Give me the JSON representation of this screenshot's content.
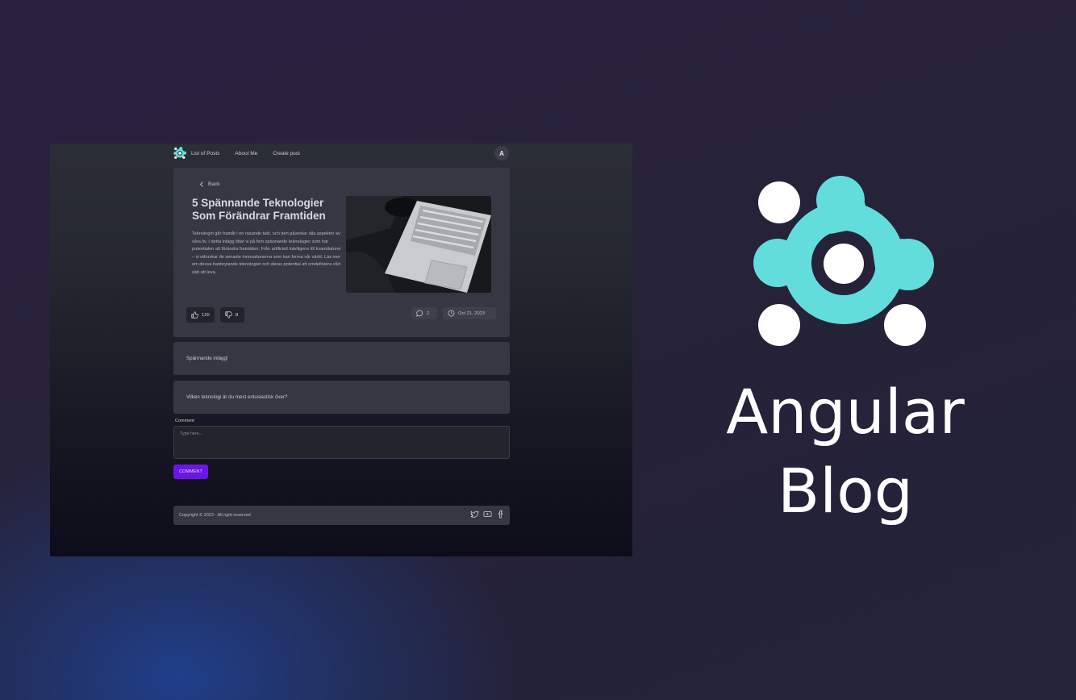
{
  "nav": {
    "links": [
      "List of Posts",
      "About Me",
      "Create post"
    ],
    "avatar_initial": "A"
  },
  "post": {
    "back_label": "Back",
    "title": "5 Spännande Teknologier Som Förändrar Framtiden",
    "excerpt": "Teknologin går framåt i en rasande takt, och den påverkar alla aspekter av våra liv. I detta inlägg tittar vi på fem spännande teknologier som har potentialen att förändra framtiden. Från artificiell intelligens till kvantdatorer – vi utforskar de senaste innovationerna som kan forma vår värld. Läs mer om dessa banbrytande teknologier och deras potential att omdefiniera vårt sätt att leva.",
    "likes": "120",
    "dislikes": "8",
    "comments_count": "2",
    "date": "Oct 21, 2023"
  },
  "comments": [
    "Spännande inlägg!",
    "Vilken teknologi är du mest entusiastisk över?"
  ],
  "comment_form": {
    "label": "Comment",
    "placeholder": "Type here...",
    "submit_label": "COMMENT"
  },
  "footer": {
    "copyright": "Copyright © 2023 - All right reserved",
    "social_icons": [
      "twitter-icon",
      "youtube-icon",
      "facebook-icon"
    ]
  },
  "brand": {
    "line1": "Angular",
    "line2": "Blog"
  },
  "colors": {
    "accent": "#6a16e6",
    "logo_teal": "#63dcdc",
    "card": "#353843"
  }
}
